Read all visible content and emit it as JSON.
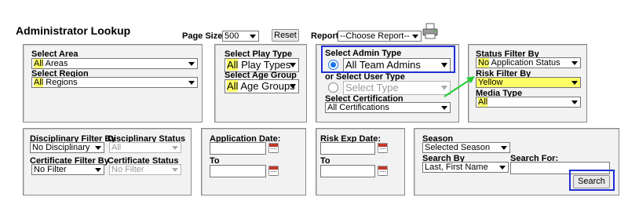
{
  "page": {
    "title": "Administrator Lookup",
    "page_size_label": "Page Size:",
    "page_size_value": "500",
    "reset_label": "Reset",
    "report_label": "Report:",
    "report_value": "--Choose Report--",
    "printer_icon": "printer-icon"
  },
  "area_panel": {
    "area_label": "Select Area",
    "area_value_hl": "All",
    "area_value_rest": " Areas",
    "region_label": "Select Region",
    "region_value_hl": "All",
    "region_value_rest": " Regions"
  },
  "play_panel": {
    "play_label": "Select Play Type",
    "play_value_hl": "All",
    "play_value_rest": " Play Types",
    "age_label": "Select Age Group",
    "age_value_hl": "All",
    "age_value_rest": " Age Groups"
  },
  "admin_panel": {
    "admin_type_label": "Select Admin Type",
    "admin_type_value": "All Team Admins",
    "user_type_label": "or Select User Type",
    "user_type_placeholder": "Select Type",
    "cert_label": "Select Certification",
    "cert_value": "All Certifications"
  },
  "status_panel": {
    "status_label": "Status Filter By",
    "status_value_hl": "No",
    "status_value_rest": " Application Status",
    "risk_label": "Risk Filter By",
    "risk_value": "Yellow",
    "media_label": "Media Type",
    "media_value": "All"
  },
  "disc_panel": {
    "disc_filter_label": "Disciplinary Filter By",
    "disc_status_label": "Disciplinary Status",
    "disc_filter_value": "No Disciplinary",
    "disc_status_value": "All",
    "cert_filter_label": "Certificate Filter By",
    "cert_status_label": "Certificate Status",
    "cert_filter_value": "No Filter",
    "cert_status_value": "No Filter"
  },
  "app_date_panel": {
    "label": "Application Date:",
    "to_label": "To"
  },
  "risk_exp_panel": {
    "label": "Risk Exp Date:",
    "to_label": "To"
  },
  "season_panel": {
    "season_label": "Season",
    "season_value": "Selected Season",
    "search_by_label": "Search By",
    "search_by_value": "Last, First Name",
    "search_for_label": "Search For:",
    "search_button": "Search"
  },
  "colors": {
    "highlight": "#ffff66",
    "annotation_blue": "#1f2fd6",
    "annotation_green": "#22cc33",
    "radio_blue": "#1a73e8"
  }
}
